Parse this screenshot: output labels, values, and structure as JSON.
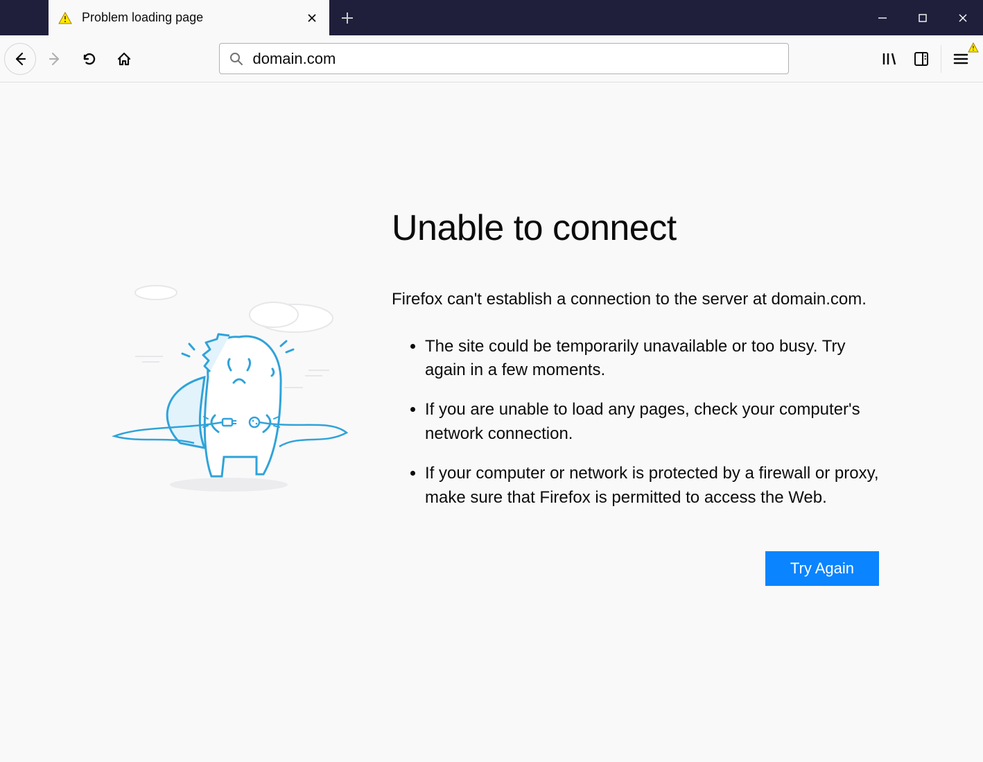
{
  "tab": {
    "title": "Problem loading page"
  },
  "urlbar": {
    "value": "domain.com"
  },
  "error": {
    "title": "Unable to connect",
    "description": "Firefox can't establish a connection to the server at domain.com.",
    "bullets": [
      "The site could be temporarily unavailable or too busy. Try again in a few moments.",
      "If you are unable to load any pages, check your computer's network connection.",
      "If your computer or network is protected by a firewall or proxy, make sure that Firefox is permitted to access the Web."
    ],
    "retry_label": "Try Again"
  }
}
